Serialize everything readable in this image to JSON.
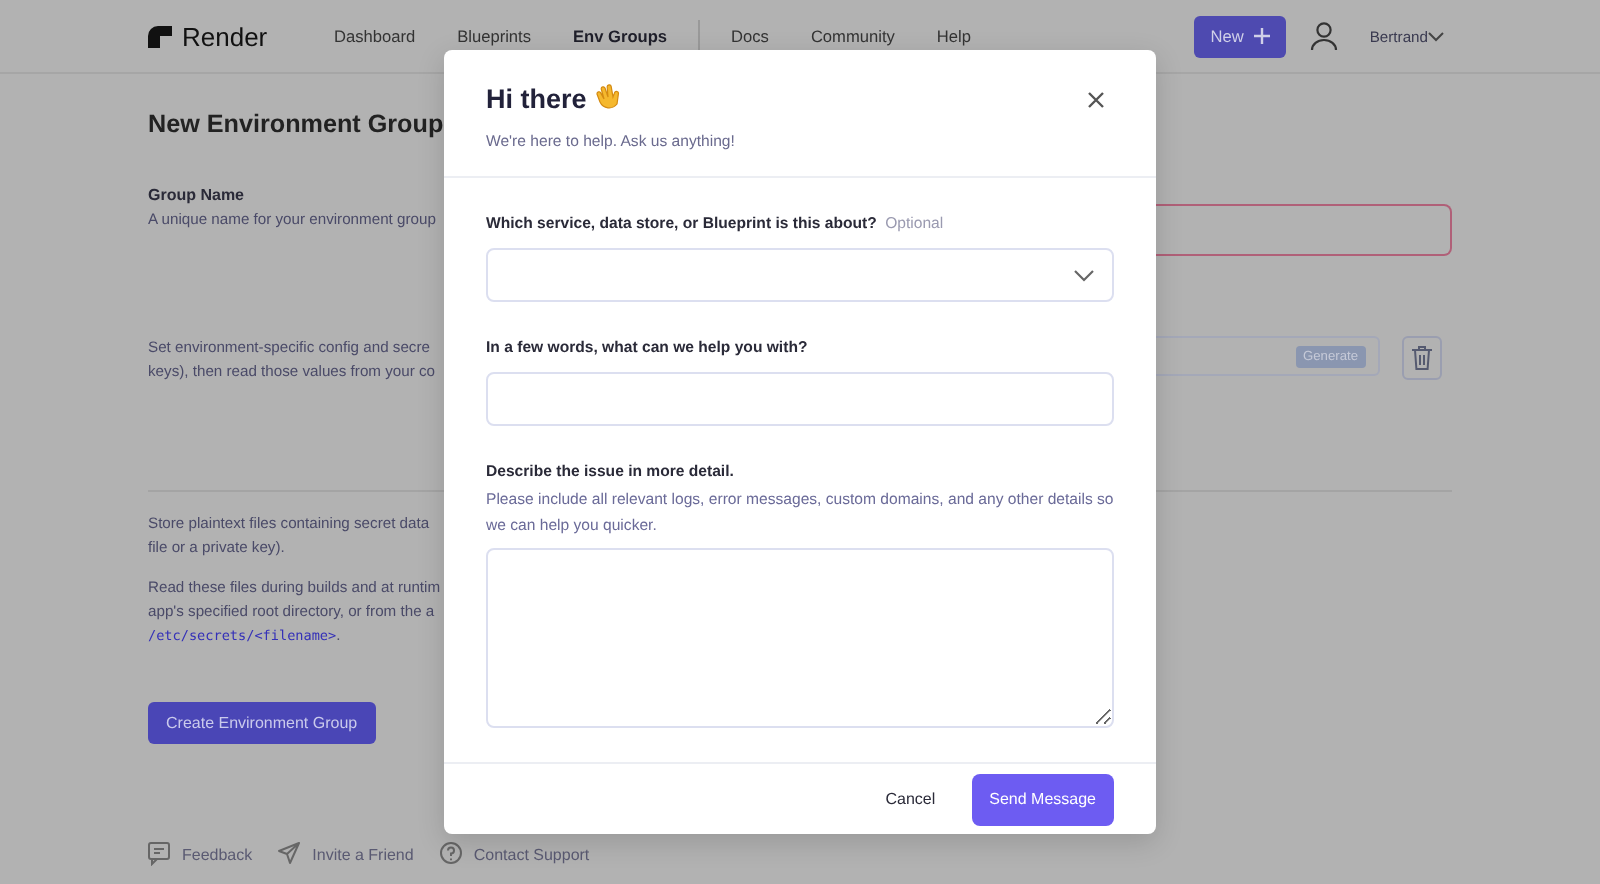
{
  "header": {
    "logo": "Render",
    "nav": [
      {
        "label": "Dashboard",
        "selected": false
      },
      {
        "label": "Blueprints",
        "selected": false
      },
      {
        "label": "Env Groups",
        "selected": true
      },
      {
        "label": "Docs",
        "selected": false
      },
      {
        "label": "Community",
        "selected": false
      },
      {
        "label": "Help",
        "selected": false
      }
    ],
    "new_button": "New",
    "user": "Bertrand"
  },
  "page": {
    "title": "New Environment Group",
    "group_name": {
      "label": "Group Name",
      "help": "A unique name for your environment group"
    },
    "env_help": [
      "Set environment-specific config and secre",
      "keys), then read those values from your co"
    ],
    "generate_button": "Generate",
    "files_help": [
      "Store plaintext files containing secret data",
      "file or a private key)."
    ],
    "files_help_2": [
      "Read these files during builds and at runtim",
      "app's specified root directory, or from the a"
    ],
    "path": "/etc/secrets/<filename>",
    "path_suffix": ".",
    "create_button": "Create Environment Group"
  },
  "footer_links": [
    {
      "kind": "feedback",
      "label": "Feedback"
    },
    {
      "kind": "invite",
      "label": "Invite a Friend"
    },
    {
      "kind": "support",
      "label": "Contact Support"
    }
  ],
  "modal": {
    "title": "Hi there",
    "subtitle": "We're here to help. Ask us anything!",
    "service": {
      "label": "Which service, data store, or Blueprint is this about?",
      "optional": "Optional"
    },
    "summary": {
      "label": "In a few words, what can we help you with?"
    },
    "details": {
      "label": "Describe the issue in more detail.",
      "help": "Please include all relevant logs, error messages, custom domains, and any other details so we can help you quicker."
    },
    "cancel": "Cancel",
    "send": "Send Message"
  }
}
